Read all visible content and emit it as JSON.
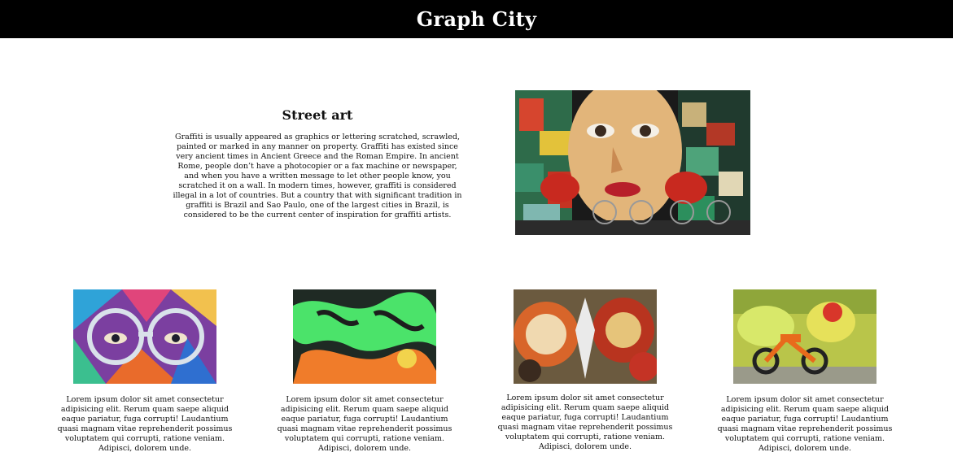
{
  "header": {
    "title": "Graph City"
  },
  "feature": {
    "heading": "Street art",
    "body": "Graffiti is usually appeared as graphics or lettering scratched, scrawled, painted or marked in any manner on property. Graffiti has existed since very ancient times in Ancient Greece and the Roman Empire. In ancient Rome, people don’t have a photocopier or a fax machine or newspaper, and when you have a written message to let other people know, you scratched it on a wall. In modern times, however, graffiti is considered illegal in a lot of countries. But a country that with significant tradition in graffiti is Brazil and Sao Paulo, one of the largest cities in Brazil, is considered to be the current center of inspiration for graffiti artists."
  },
  "cards": [
    {
      "text": "Lorem ipsum dolor sit amet consectetur adipisicing elit. Rerum quam saepe aliquid eaque pariatur, fuga corrupti! Laudantium quasi magnam vitae reprehenderit possimus voluptatem qui corrupti, ratione veniam. Adipisci, dolorem unde."
    },
    {
      "text": "Lorem ipsum dolor sit amet consectetur adipisicing elit. Rerum quam saepe aliquid eaque pariatur, fuga corrupti! Laudantium quasi magnam vitae reprehenderit possimus voluptatem qui corrupti, ratione veniam. Adipisci, dolorem unde."
    },
    {
      "text": "Lorem ipsum dolor sit amet consectetur adipisicing elit. Rerum quam saepe aliquid eaque pariatur, fuga corrupti! Laudantium quasi magnam vitae reprehenderit possimus voluptatem qui corrupti, ratione veniam. Adipisci, dolorem unde."
    },
    {
      "text": "Lorem ipsum dolor sit amet consectetur adipisicing elit. Rerum quam saepe aliquid eaque pariatur, fuga corrupti! Laudantium quasi magnam vitae reprehenderit possimus voluptatem qui corrupti, ratione veniam. Adipisci, dolorem unde."
    }
  ],
  "colors": {
    "header_background": "#000000",
    "header_text": "#ffffff",
    "page_background": "#ffffff"
  }
}
